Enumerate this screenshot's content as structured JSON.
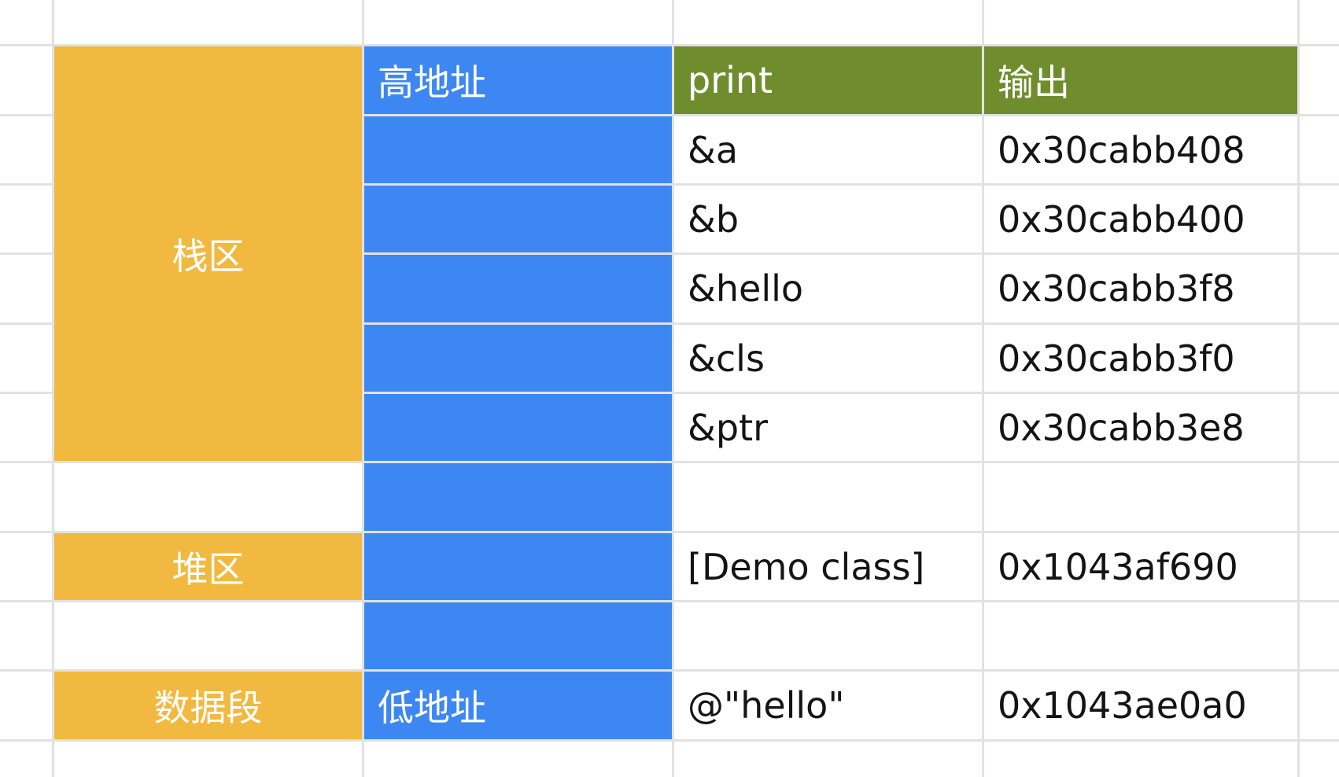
{
  "colors": {
    "stack_region": "#f2b940",
    "address_column": "#3d87f2",
    "header_green": "#6f8d2d",
    "grid_line": "#e2e2e2",
    "cell_text": "#141414",
    "header_text": "#ffffff"
  },
  "regions": {
    "stack": "栈区",
    "heap": "堆区",
    "data_segment": "数据段"
  },
  "address_column": {
    "high": "高地址",
    "low": "低地址"
  },
  "table": {
    "headers": {
      "print": "print",
      "output": "输出"
    },
    "rows": [
      {
        "print": "&a",
        "output": "0x30cabb408"
      },
      {
        "print": "&b",
        "output": "0x30cabb400"
      },
      {
        "print": "&hello",
        "output": "0x30cabb3f8"
      },
      {
        "print": "&cls",
        "output": "0x30cabb3f0"
      },
      {
        "print": "&ptr",
        "output": "0x30cabb3e8"
      },
      {
        "print": "",
        "output": ""
      },
      {
        "print": "[Demo class]",
        "output": "0x1043af690"
      },
      {
        "print": "",
        "output": ""
      },
      {
        "print": "@\"hello\"",
        "output": "0x1043ae0a0"
      }
    ]
  }
}
